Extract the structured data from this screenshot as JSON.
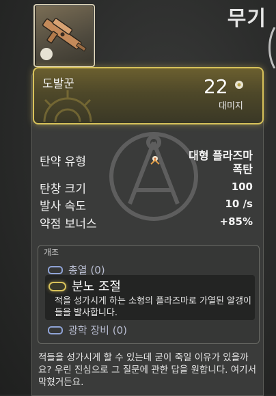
{
  "header": {
    "title": "무기"
  },
  "weapon": {
    "name": "도발꾼",
    "damage": "22",
    "damage_label": "대미지"
  },
  "stats": [
    {
      "label": "탄약 유형",
      "value_line1": "대형 플라즈마",
      "value_line2": "폭탄"
    },
    {
      "label": "탄창 크기",
      "value": "100"
    },
    {
      "label": "발사 속도",
      "value": "10 /s"
    },
    {
      "label": "약점 보너스",
      "value": "+85%"
    }
  ],
  "mods": {
    "title": "개조",
    "items": [
      {
        "name": "총열 (0)"
      },
      {
        "name": "분노 조절",
        "description": "적을 성가시게 하는 소형의 플라즈마로 가열된 알갱이들을 발사합니다."
      },
      {
        "name": "광학 장비 (0)"
      }
    ]
  },
  "flavor_text": "적들을 성가시게 할 수 있는데 굳이 죽일 이유가 있을까요? 우린 진심으로 그 질문에 관한 답을 원합니다. 여기서 막혔거든요.",
  "colors": {
    "accent_gold": "#d8c25a",
    "mod_blue": "#8fa3d6",
    "panel": "#3a3b3a"
  },
  "icons": {
    "weapon_thumbnail": "gun-thumbnail-icon",
    "damage": "plasma-damage-icon",
    "ammo": "plasma-ammo-icon"
  }
}
